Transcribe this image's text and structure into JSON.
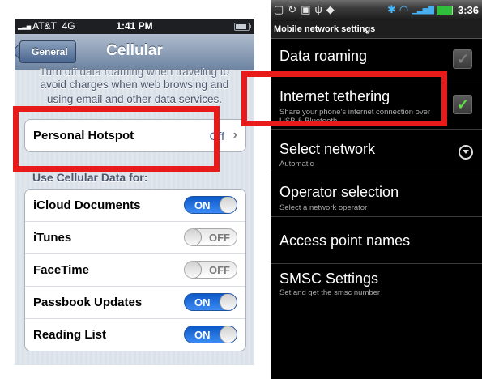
{
  "ios": {
    "status": {
      "carrier": "AT&T",
      "network": "4G",
      "time": "1:41 PM"
    },
    "nav": {
      "back_label": "General",
      "title": "Cellular"
    },
    "note_lines": [
      "Turn off data roaming when traveling to",
      "avoid charges when web browsing and",
      "using email and other data services."
    ],
    "hotspot": {
      "label": "Personal Hotspot",
      "value": "Off",
      "chevron": "›"
    },
    "section_header": "Use Cellular Data for:",
    "toggles": [
      {
        "label": "iCloud Documents",
        "state": "ON",
        "on": true
      },
      {
        "label": "iTunes",
        "state": "OFF",
        "on": false
      },
      {
        "label": "FaceTime",
        "state": "OFF",
        "on": false
      },
      {
        "label": "Passbook Updates",
        "state": "ON",
        "on": true
      },
      {
        "label": "Reading List",
        "state": "ON",
        "on": true
      }
    ]
  },
  "android": {
    "status": {
      "time": "3:36",
      "left_icons": [
        "notification-icons"
      ],
      "accent": "#49b9ff"
    },
    "title": "Mobile network settings",
    "items": [
      {
        "title": "Data roaming",
        "summary": "",
        "control": "checkbox",
        "checked": false
      },
      {
        "title": "Internet tethering",
        "summary": "Share your phone's internet connection over USB & Bluetooth",
        "control": "checkbox",
        "checked": true
      },
      {
        "title": "Select network",
        "summary": "Automatic",
        "control": "dropdown"
      },
      {
        "title": "Operator selection",
        "summary": "Select a network operator",
        "control": "none"
      },
      {
        "title": "Access point names",
        "summary": "",
        "control": "none"
      },
      {
        "title": "SMSC Settings",
        "summary": "Set and get the smsc number",
        "control": "none"
      }
    ]
  },
  "highlight_color": "#e81a1a"
}
